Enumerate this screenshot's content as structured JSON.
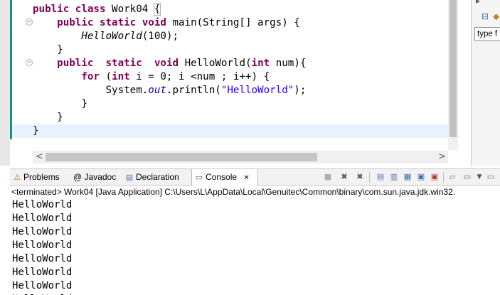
{
  "editor": {
    "lines": [
      [
        {
          "t": "public",
          "c": "kw"
        },
        {
          "t": " "
        },
        {
          "t": "class",
          "c": "kw"
        },
        {
          "t": " Work04 "
        },
        {
          "t": "{",
          "c": "brace-box"
        }
      ],
      [
        {
          "t": "    "
        },
        {
          "t": "public",
          "c": "kw"
        },
        {
          "t": " "
        },
        {
          "t": "static",
          "c": "kw"
        },
        {
          "t": " "
        },
        {
          "t": "void",
          "c": "kw"
        },
        {
          "t": " main(String[] args) {"
        }
      ],
      [
        {
          "t": "        "
        },
        {
          "t": "HelloWorld",
          "c": "ital"
        },
        {
          "t": "(100);"
        }
      ],
      [
        {
          "t": "    }"
        }
      ],
      [
        {
          "t": "    "
        },
        {
          "t": "public",
          "c": "kw"
        },
        {
          "t": "  "
        },
        {
          "t": "static",
          "c": "kw"
        },
        {
          "t": "  "
        },
        {
          "t": "void",
          "c": "kw"
        },
        {
          "t": " HelloWorld("
        },
        {
          "t": "int",
          "c": "kw"
        },
        {
          "t": " num){"
        }
      ],
      [
        {
          "t": "        "
        },
        {
          "t": "for",
          "c": "kw"
        },
        {
          "t": " ("
        },
        {
          "t": "int",
          "c": "kw"
        },
        {
          "t": " i = 0; i <num ; i++) {"
        }
      ],
      [
        {
          "t": "            System."
        },
        {
          "t": "out",
          "c": "field"
        },
        {
          "t": ".println("
        },
        {
          "t": "\"HelloWorld\"",
          "c": "str"
        },
        {
          "t": ");"
        }
      ],
      [
        {
          "t": "        }"
        }
      ],
      [
        {
          "t": "    }"
        }
      ],
      [
        {
          "t": "}"
        }
      ]
    ],
    "current_line": 9,
    "fold_markers": [
      1,
      4
    ],
    "hscroll_left": "<",
    "hscroll_right": ">"
  },
  "outline": {
    "filter_placeholder": "type f",
    "filter_value": "type f"
  },
  "tabs": [
    {
      "label": "Problems",
      "icon": "problems-icon",
      "glyph": "⚠"
    },
    {
      "label": "@ Javadoc",
      "icon": "javadoc-icon",
      "glyph": ""
    },
    {
      "label": "Declaration",
      "icon": "declaration-icon",
      "glyph": "▤"
    },
    {
      "label": "Console",
      "icon": "console-icon",
      "glyph": "▭",
      "close": "✕"
    }
  ],
  "console": {
    "description": "<terminated> Work04 [Java Application] C:\\Users\\L\\AppData\\Local\\Genuitec\\Common\\binary\\com.sun.java.jdk.win32.",
    "output": [
      "HelloWorld",
      "HelloWorld",
      "HelloWorld",
      "HelloWorld",
      "HelloWorld",
      "HelloWorld",
      "HelloWorld",
      "HelloWorld"
    ]
  },
  "colors": {
    "keyword": "#7f0055",
    "string": "#2a00ff",
    "field": "#0000c0",
    "current_line": "#e8f2fe"
  }
}
